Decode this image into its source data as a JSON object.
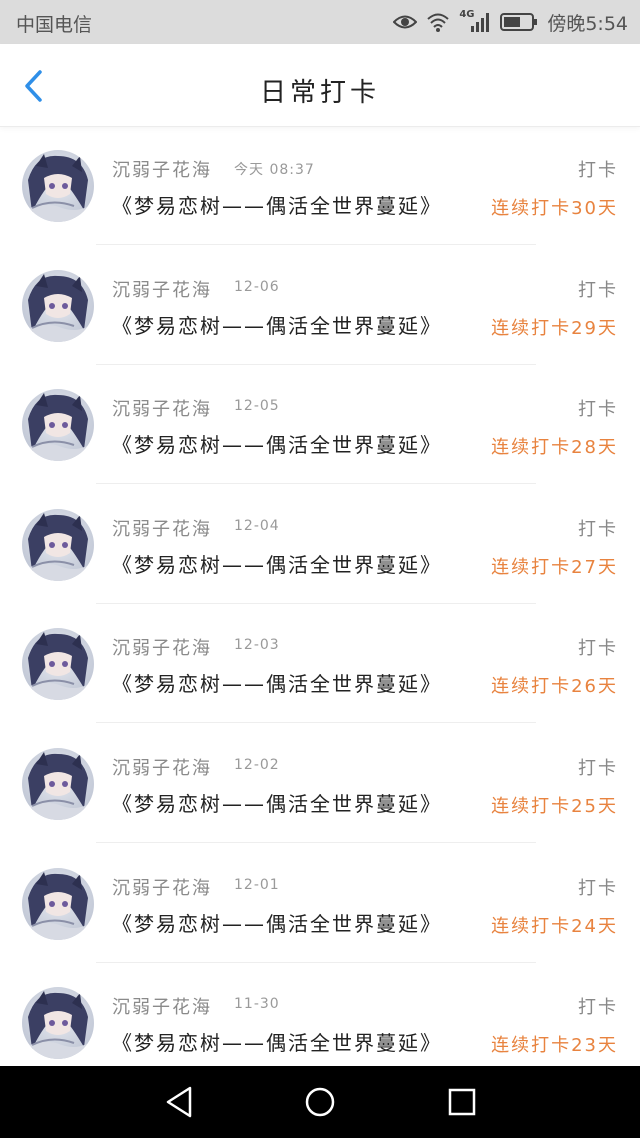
{
  "status_bar": {
    "carrier": "中国电信",
    "network": "4G",
    "time": "傍晚5:54",
    "icons": [
      "eye-icon",
      "wifi-icon",
      "signal-icon",
      "battery-icon"
    ]
  },
  "header": {
    "title": "日常打卡",
    "back_icon": "chevron-left-icon"
  },
  "colors": {
    "accent_blue": "#2f8fe8",
    "streak_orange": "#e8833f"
  },
  "list": {
    "items": [
      {
        "name": "沉弱子花海",
        "time": "今天 08:37",
        "title": "《梦易恋树——偶活全世界蔓延》",
        "type": "打卡",
        "streak": "连续打卡30天"
      },
      {
        "name": "沉弱子花海",
        "time": "12-06",
        "title": "《梦易恋树——偶活全世界蔓延》",
        "type": "打卡",
        "streak": "连续打卡29天"
      },
      {
        "name": "沉弱子花海",
        "time": "12-05",
        "title": "《梦易恋树——偶活全世界蔓延》",
        "type": "打卡",
        "streak": "连续打卡28天"
      },
      {
        "name": "沉弱子花海",
        "time": "12-04",
        "title": "《梦易恋树——偶活全世界蔓延》",
        "type": "打卡",
        "streak": "连续打卡27天"
      },
      {
        "name": "沉弱子花海",
        "time": "12-03",
        "title": "《梦易恋树——偶活全世界蔓延》",
        "type": "打卡",
        "streak": "连续打卡26天"
      },
      {
        "name": "沉弱子花海",
        "time": "12-02",
        "title": "《梦易恋树——偶活全世界蔓延》",
        "type": "打卡",
        "streak": "连续打卡25天"
      },
      {
        "name": "沉弱子花海",
        "time": "12-01",
        "title": "《梦易恋树——偶活全世界蔓延》",
        "type": "打卡",
        "streak": "连续打卡24天"
      },
      {
        "name": "沉弱子花海",
        "time": "11-30",
        "title": "《梦易恋树——偶活全世界蔓延》",
        "type": "打卡",
        "streak": "连续打卡23天"
      }
    ]
  },
  "nav_bar": {
    "icons": [
      "back-triangle-icon",
      "home-circle-icon",
      "recents-square-icon"
    ]
  }
}
